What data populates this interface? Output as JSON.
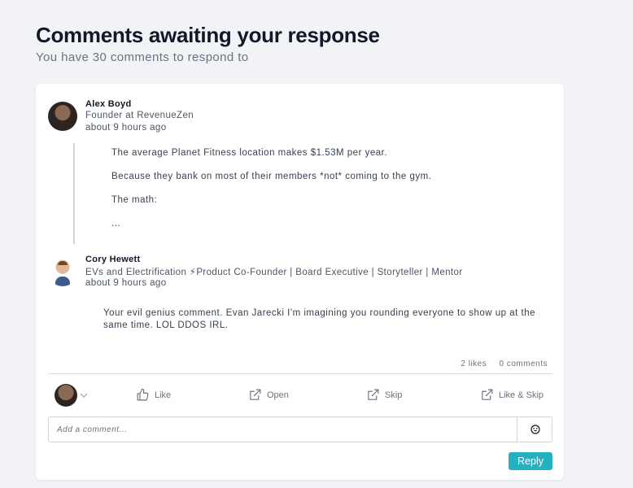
{
  "header": {
    "title": "Comments awaiting your response",
    "subtitle": "You have 30 comments to respond to"
  },
  "post": {
    "author_name": "Alex Boyd",
    "author_headline": "Founder at RevenueZen",
    "timestamp": "about 9 hours ago",
    "lines": [
      "The average Planet Fitness location makes $1.53M per year.",
      "Because they bank on most of their members *not* coming to the gym.",
      "The math:",
      "..."
    ]
  },
  "comment": {
    "author_name": "Cory Hewett",
    "author_headline": "EVs and Electrification ⚡Product Co-Founder | Board Executive | Storyteller | Mentor",
    "timestamp": "about 9 hours ago",
    "text": "Your evil genius comment.  Evan Jarecki I'm imagining you rounding everyone to show up at the same time. LOL DDOS IRL.",
    "likes": "2 likes",
    "comments": "0 comments"
  },
  "actions": {
    "like": "Like",
    "open": "Open",
    "skip": "Skip",
    "like_skip": "Like & Skip"
  },
  "composer": {
    "placeholder": "Add a comment...",
    "reply_label": "Reply"
  },
  "icons": {
    "like": "thumbs-up-icon",
    "open": "external-link-icon",
    "skip": "external-link-icon",
    "like_skip": "external-link-icon",
    "emoji": "smiley-icon",
    "chevron": "chevron-down-icon"
  },
  "colors": {
    "accent": "#26b1c1",
    "background": "#f1f3f6"
  }
}
